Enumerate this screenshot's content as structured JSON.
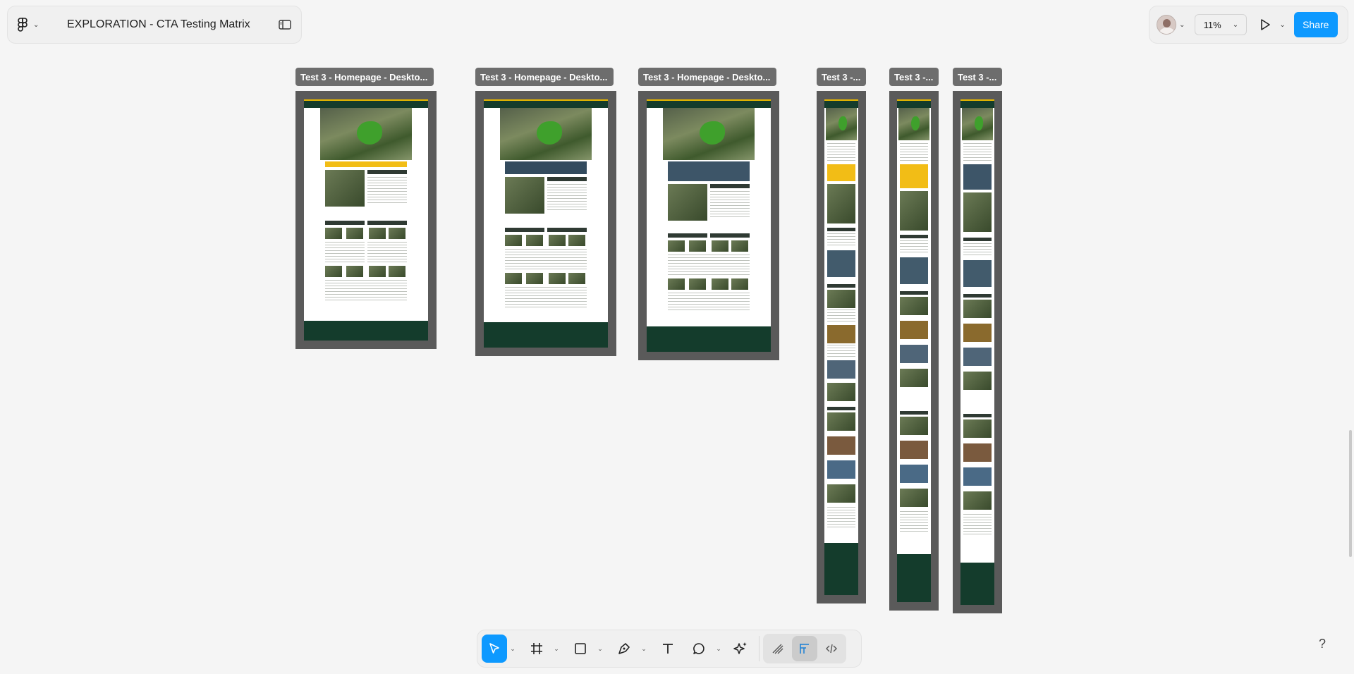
{
  "app": {
    "file_title": "EXPLORATION - CTA Testing Matrix",
    "zoom_label": "11%",
    "share_label": "Share",
    "help_label": "?"
  },
  "frames": [
    {
      "label": "Test 3 - Homepage  - Deskto...",
      "variant": "desktop"
    },
    {
      "label": "Test 3 - Homepage  - Deskto...",
      "variant": "desktop"
    },
    {
      "label": "Test 3 - Homepage  - Deskto...",
      "variant": "desktop"
    },
    {
      "label": "Test 3 -...",
      "variant": "mobile"
    },
    {
      "label": "Test 3 -...",
      "variant": "mobile"
    },
    {
      "label": "Test 3 -...",
      "variant": "mobile"
    }
  ],
  "toolbar": {
    "tools": [
      "move-tool",
      "frame-tool",
      "shape-tool",
      "pen-tool",
      "text-tool",
      "comment-tool",
      "actions-tool"
    ],
    "dev_tools": [
      "draw-mode",
      "design-mode",
      "dev-mode"
    ],
    "active_tool": "move-tool",
    "active_mode": "design-mode"
  },
  "colors": {
    "accent": "#0d99ff",
    "canvas": "#f5f5f5",
    "site_green": "#143c2c",
    "site_yellow": "#f2bd16"
  }
}
